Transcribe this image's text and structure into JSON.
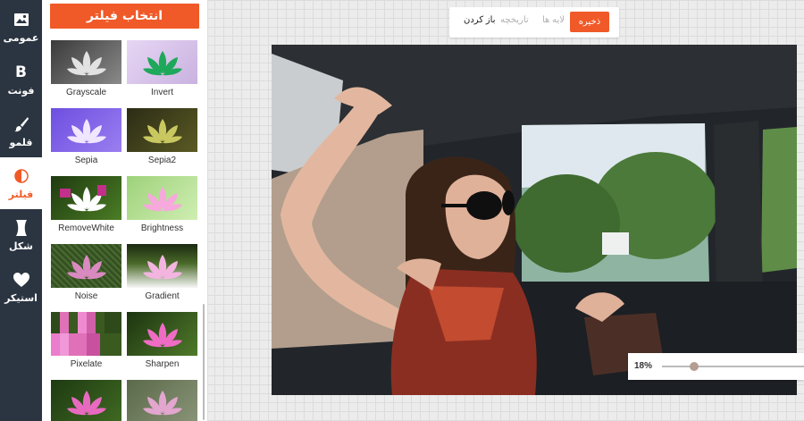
{
  "sidebar": {
    "items": [
      {
        "label": "عمومی",
        "icon": "image-icon"
      },
      {
        "label": "فونت",
        "icon": "font-b-icon"
      },
      {
        "label": "قلمو",
        "icon": "brush-icon"
      },
      {
        "label": "فیلتر",
        "icon": "filter-icon",
        "active": true
      },
      {
        "label": "شکل",
        "icon": "shape-icon"
      },
      {
        "label": "استیکر",
        "icon": "heart-icon"
      }
    ]
  },
  "filter_panel": {
    "title": "انتخاب فیلتر",
    "filters": [
      "Grayscale",
      "Invert",
      "Sepia",
      "Sepia2",
      "RemoveWhite",
      "Brightness",
      "Noise",
      "Gradient",
      "Pixelate",
      "Sharpen",
      "",
      ""
    ]
  },
  "toolbar": {
    "save": "ذخیره",
    "layers": "لایه ها",
    "history": "تاریخچه",
    "open": "باز کردن"
  },
  "zoom": {
    "label": "18%",
    "level": 0.18
  },
  "colors": {
    "accent": "#f05a28",
    "sidebar_bg": "#2b3541"
  }
}
